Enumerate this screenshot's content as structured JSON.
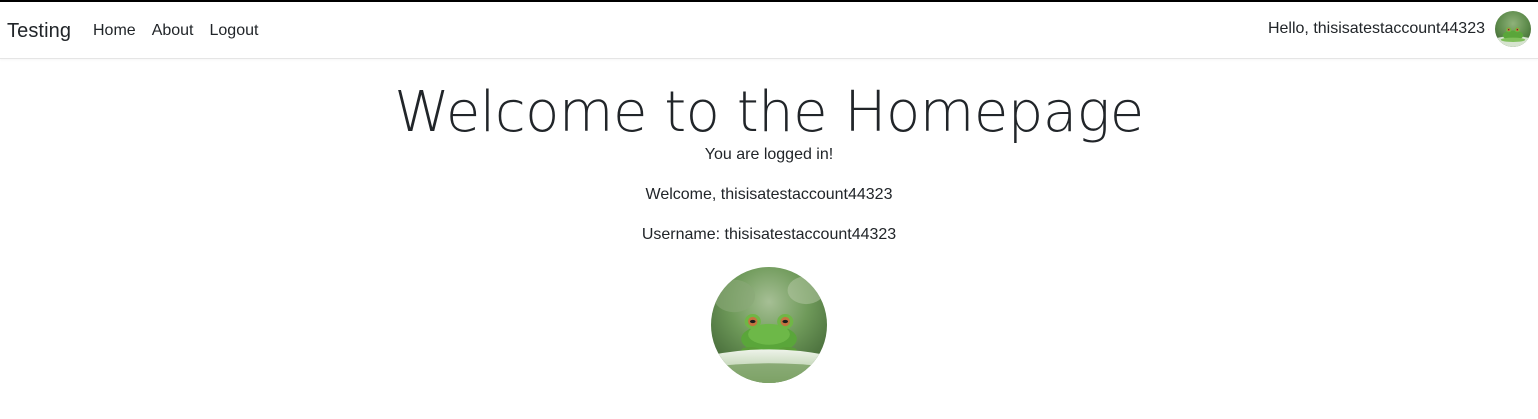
{
  "nav": {
    "brand": "Testing",
    "links": [
      "Home",
      "About",
      "Logout"
    ],
    "greeting": "Hello, thisisatestaccount44323"
  },
  "main": {
    "title": "Welcome to the Homepage",
    "status": "You are logged in!",
    "welcome": "Welcome, thisisatestaccount44323",
    "username": "Username: thisisatestaccount44323"
  },
  "colors": {
    "text": "#212529",
    "navbar_bg": "#ffffff",
    "frog_green": "#5aa63a"
  },
  "icons": {
    "avatar": "frog-photo-avatar"
  }
}
